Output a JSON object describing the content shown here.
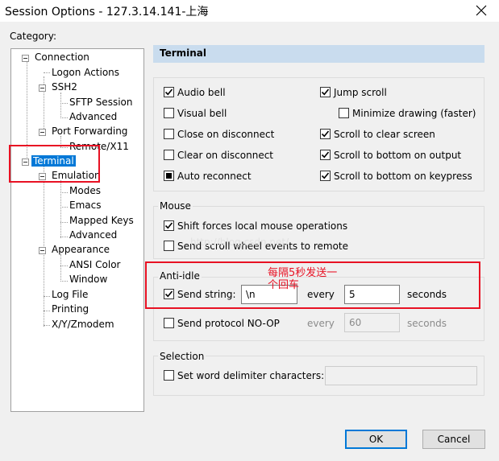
{
  "window": {
    "title": "Session Options - 127.3.14.141-上海"
  },
  "category_label": "Category:",
  "tree": {
    "connection": "Connection",
    "logon_actions": "Logon Actions",
    "ssh2": "SSH2",
    "sftp_session": "SFTP Session",
    "ssh2_advanced": "Advanced",
    "port_forwarding": "Port Forwarding",
    "remote_x11": "Remote/X11",
    "terminal": "Terminal",
    "emulation": "Emulation",
    "modes": "Modes",
    "emacs": "Emacs",
    "mapped_keys": "Mapped Keys",
    "emulation_advanced": "Advanced",
    "appearance": "Appearance",
    "ansi_color": "ANSI Color",
    "window": "Window",
    "log_file": "Log File",
    "printing": "Printing",
    "xyzmodem": "X/Y/Zmodem"
  },
  "panel_title": "Terminal",
  "options": {
    "audio_bell": "Audio bell",
    "visual_bell": "Visual bell",
    "close_on_disconnect": "Close on disconnect",
    "clear_on_disconnect": "Clear on disconnect",
    "auto_reconnect": "Auto reconnect",
    "jump_scroll": "Jump scroll",
    "minimize_drawing": "Minimize drawing (faster)",
    "scroll_clear": "Scroll to clear screen",
    "scroll_bottom_output": "Scroll to bottom on output",
    "scroll_bottom_keypress": "Scroll to bottom on keypress"
  },
  "mouse": {
    "legend": "Mouse",
    "shift_forces": "Shift forces local mouse operations",
    "send_scroll": "Send scroll wheel events to remote"
  },
  "watermark": "http://blog.csdn.net/",
  "anti_idle": {
    "legend": "Anti-idle",
    "send_string_label": "Send string:",
    "send_string_value": "\\n",
    "every_label": "every",
    "every_value": "5",
    "seconds_label": "seconds",
    "send_noop_label": "Send protocol NO-OP",
    "noop_every_label": "every",
    "noop_value": "60",
    "noop_seconds_label": "seconds"
  },
  "annotation": {
    "line1": "每隔5秒发送一",
    "line2": "个回车"
  },
  "selection": {
    "legend": "Selection",
    "word_delimiter": "Set word delimiter characters:",
    "word_delimiter_value": ""
  },
  "buttons": {
    "ok": "OK",
    "cancel": "Cancel"
  },
  "colors": {
    "selected": "#0078d7",
    "header": "#c9dcee",
    "annotation": "#e81123"
  }
}
